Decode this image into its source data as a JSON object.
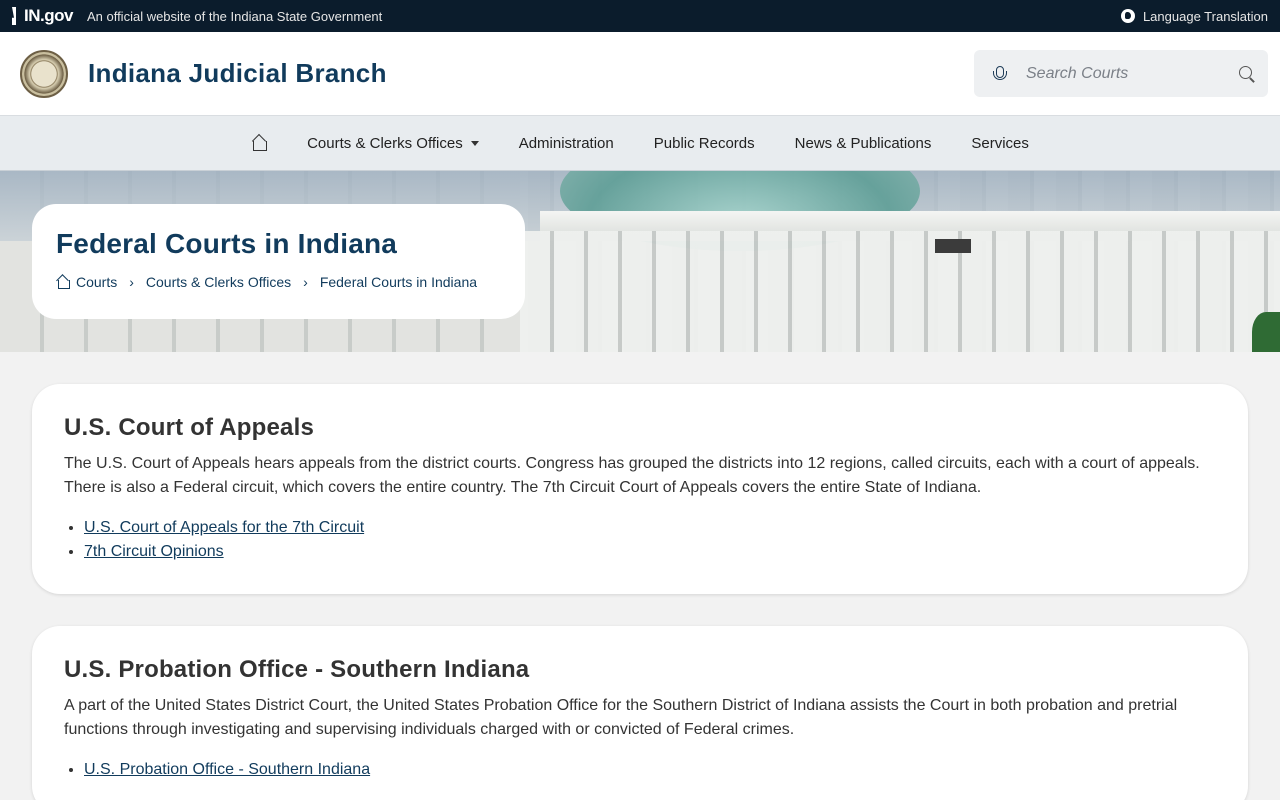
{
  "topbar": {
    "logo_text": "IN.gov",
    "official_text": "An official website of the Indiana State Government",
    "language_label": "Language Translation"
  },
  "header": {
    "brand": "Indiana Judicial Branch",
    "search_placeholder": "Search Courts"
  },
  "nav": {
    "items": [
      {
        "label": "Courts & Clerks Offices",
        "has_dropdown": true
      },
      {
        "label": "Administration"
      },
      {
        "label": "Public Records"
      },
      {
        "label": "News & Publications"
      },
      {
        "label": "Services"
      }
    ]
  },
  "hero": {
    "title": "Federal Courts in Indiana",
    "breadcrumb": [
      "Courts",
      "Courts & Clerks Offices",
      "Federal Courts in Indiana"
    ]
  },
  "sections": [
    {
      "heading": "U.S. Court of Appeals",
      "body": "The U.S. Court of Appeals hears appeals from the district courts. Congress has grouped the districts into 12 regions, called circuits, each with a court of appeals. There is also a Federal circuit, which covers the entire country. The 7th Circuit Court of Appeals covers the entire State of Indiana.",
      "links": [
        "U.S. Court of Appeals for the 7th Circuit",
        "7th Circuit Opinions"
      ]
    },
    {
      "heading": "U.S. Probation Office - Southern Indiana",
      "body": "A part of the United States District Court, the United States Probation Office for the Southern District of Indiana assists the Court in both probation and pretrial functions through investigating and supervising individuals charged with or convicted of Federal crimes.",
      "links": [
        "U.S. Probation Office - Southern Indiana"
      ]
    }
  ],
  "colors": {
    "topbar_bg": "#0b1c2c",
    "brand_blue": "#113b5c",
    "nav_bg": "#e8ecef",
    "page_bg": "#f2f2f2"
  }
}
